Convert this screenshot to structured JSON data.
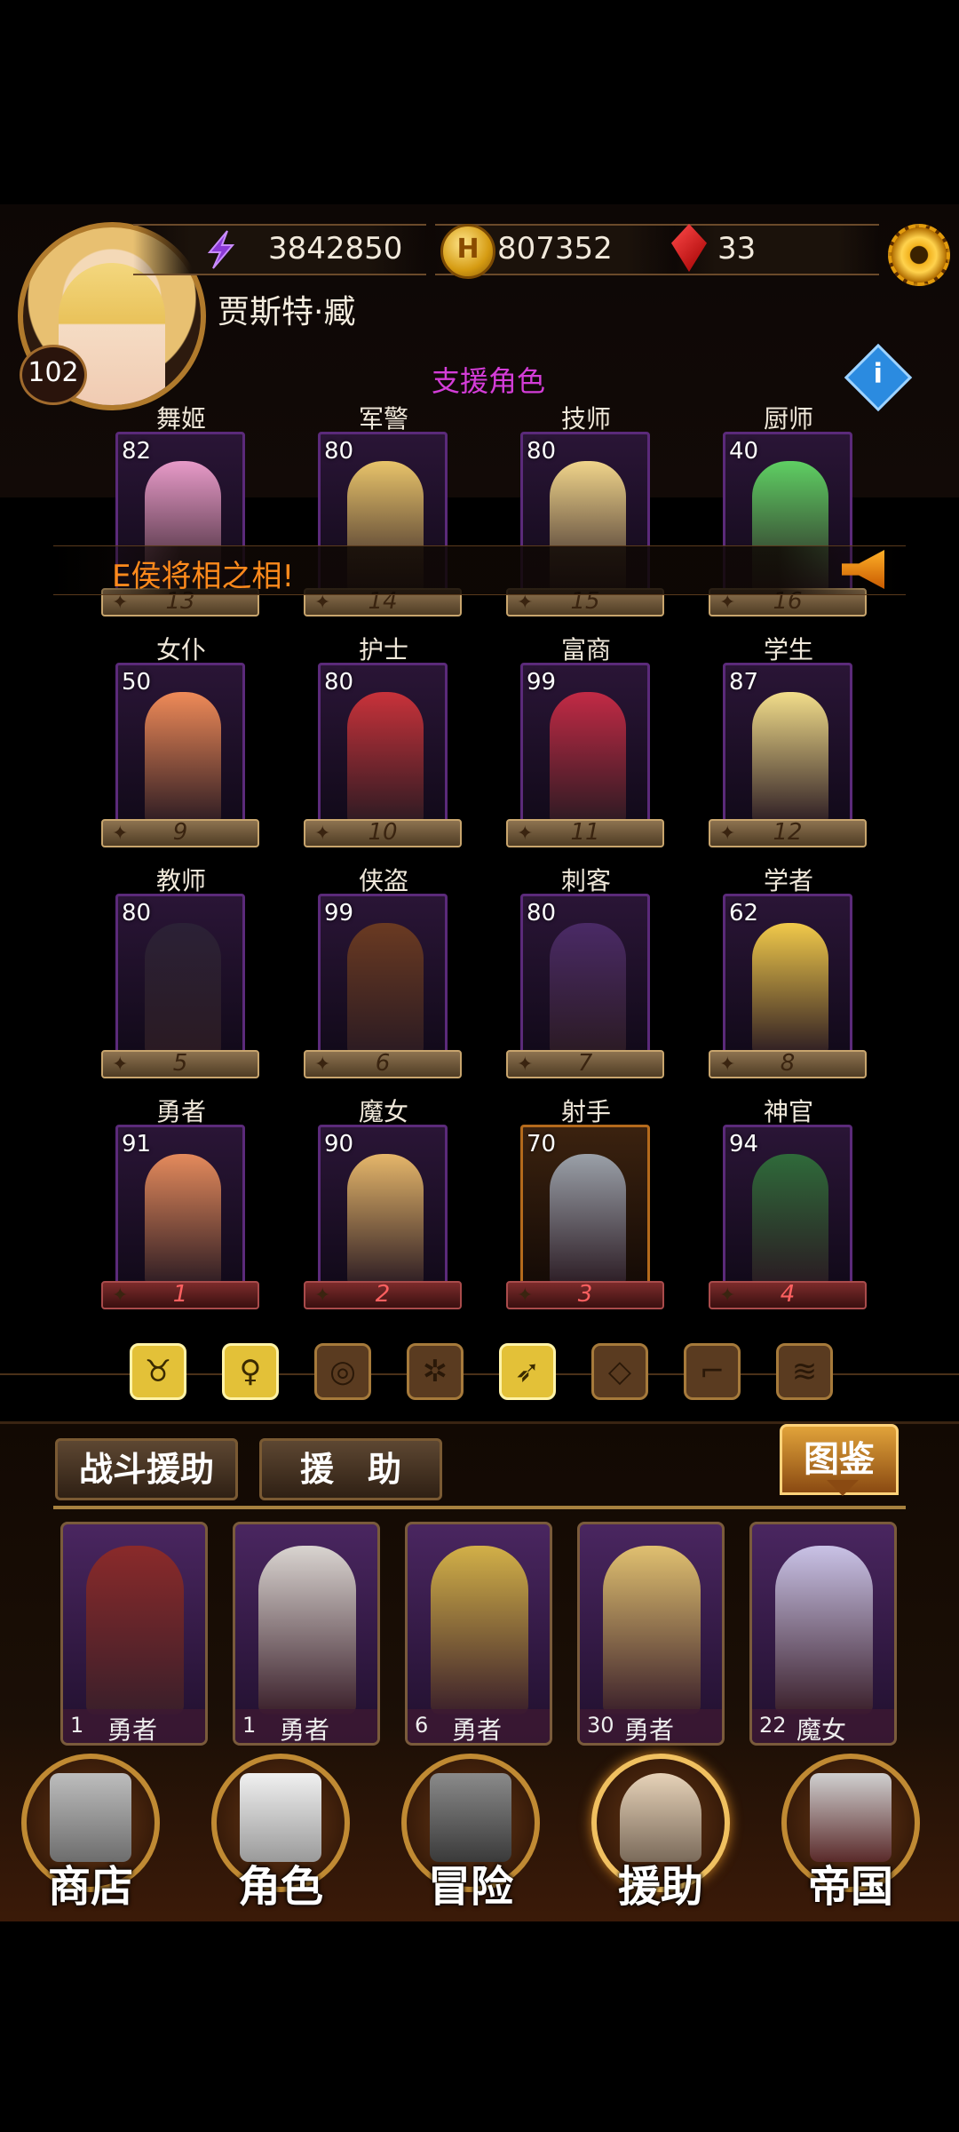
{
  "header": {
    "player_name": "贾斯特·臧",
    "level": "102",
    "power": "3842850",
    "gold": "807352",
    "gems": "33",
    "coin_symbol": "H"
  },
  "support": {
    "title": "支援角色",
    "info": "i",
    "announcement": "E侯将相之相!"
  },
  "characters": [
    {
      "role": "舞姬",
      "level": "82",
      "slot": "13"
    },
    {
      "role": "军警",
      "level": "80",
      "slot": "14"
    },
    {
      "role": "技师",
      "level": "80",
      "slot": "15"
    },
    {
      "role": "厨师",
      "level": "40",
      "slot": "16"
    },
    {
      "role": "女仆",
      "level": "50",
      "slot": "9"
    },
    {
      "role": "护士",
      "level": "80",
      "slot": "10"
    },
    {
      "role": "富商",
      "level": "99",
      "slot": "11"
    },
    {
      "role": "学生",
      "level": "87",
      "slot": "12"
    },
    {
      "role": "教师",
      "level": "80",
      "slot": "5"
    },
    {
      "role": "侠盗",
      "level": "99",
      "slot": "6"
    },
    {
      "role": "刺客",
      "level": "80",
      "slot": "7"
    },
    {
      "role": "学者",
      "level": "62",
      "slot": "8"
    },
    {
      "role": "勇者",
      "level": "91",
      "slot": "1"
    },
    {
      "role": "魔女",
      "level": "90",
      "slot": "2"
    },
    {
      "role": "射手",
      "level": "70",
      "slot": "3"
    },
    {
      "role": "神官",
      "level": "94",
      "slot": "4"
    }
  ],
  "filters": [
    {
      "icon": "bull-icon",
      "glyph": "♉",
      "active": true
    },
    {
      "icon": "silhouette-icon",
      "glyph": "♀",
      "active": true
    },
    {
      "icon": "target-icon",
      "glyph": "◎",
      "active": false
    },
    {
      "icon": "wheel-icon",
      "glyph": "✲",
      "active": false
    },
    {
      "icon": "bow-icon",
      "glyph": "➶",
      "active": true
    },
    {
      "icon": "gem-icon",
      "glyph": "◇",
      "active": false
    },
    {
      "icon": "boot-icon",
      "glyph": "⌐",
      "active": false
    },
    {
      "icon": "claw-icon",
      "glyph": "≋",
      "active": false
    }
  ],
  "assist": {
    "tab_battle": "战斗援助",
    "tab_assist": "援　助",
    "codex": "图鉴",
    "cards": [
      {
        "num": "1",
        "class": "勇者"
      },
      {
        "num": "1",
        "class": "勇者"
      },
      {
        "num": "6",
        "class": "勇者"
      },
      {
        "num": "30",
        "class": "勇者"
      },
      {
        "num": "22",
        "class": "魔女"
      }
    ]
  },
  "nav": [
    {
      "label": "商店"
    },
    {
      "label": "角色"
    },
    {
      "label": "冒险"
    },
    {
      "label": "援助"
    },
    {
      "label": "帝国"
    }
  ]
}
